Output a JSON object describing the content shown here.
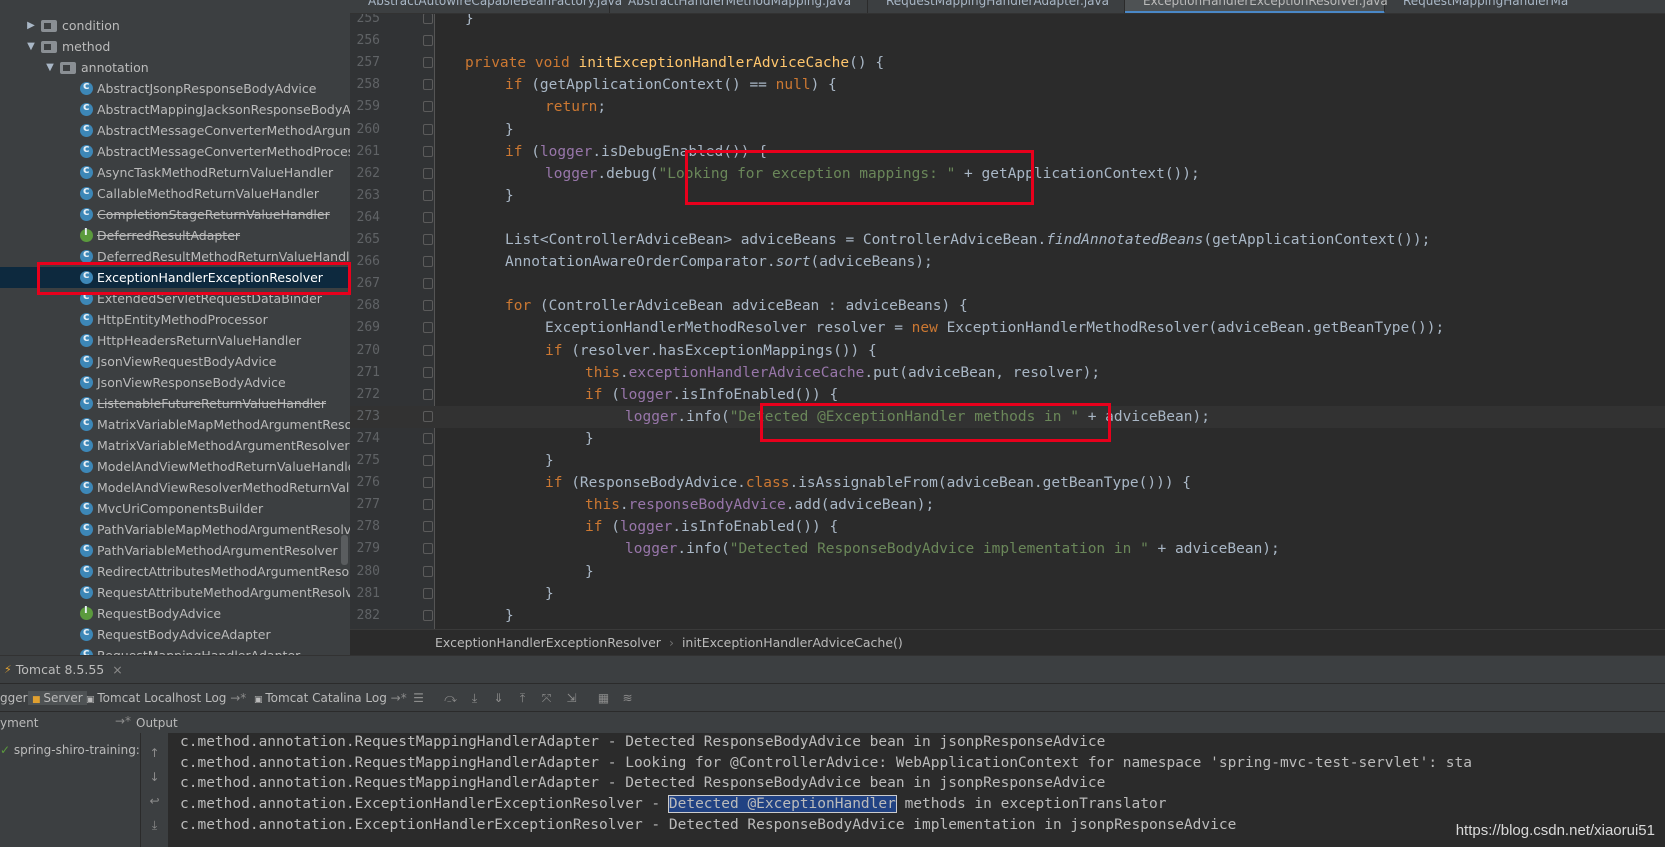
{
  "project_tree": {
    "items": [
      {
        "label": "condition",
        "kind": "folder",
        "level": 1,
        "arrow": "▶"
      },
      {
        "label": "method",
        "kind": "folder",
        "level": 1,
        "arrow": "▼"
      },
      {
        "label": "annotation",
        "kind": "folder",
        "level": 2,
        "arrow": "▼"
      },
      {
        "label": "AbstractJsonpResponseBodyAdvice",
        "kind": "class"
      },
      {
        "label": "AbstractMappingJacksonResponseBodyAd",
        "kind": "class"
      },
      {
        "label": "AbstractMessageConverterMethodArgume",
        "kind": "class"
      },
      {
        "label": "AbstractMessageConverterMethodProcess",
        "kind": "class"
      },
      {
        "label": "AsyncTaskMethodReturnValueHandler",
        "kind": "class"
      },
      {
        "label": "CallableMethodReturnValueHandler",
        "kind": "class"
      },
      {
        "label": "CompletionStageReturnValueHandler",
        "kind": "class",
        "deprecated": true
      },
      {
        "label": "DeferredResultAdapter",
        "kind": "interface",
        "deprecated": true
      },
      {
        "label": "DeferredResultMethodReturnValueHandler",
        "kind": "class"
      },
      {
        "label": "ExceptionHandlerExceptionResolver",
        "kind": "class",
        "selected": true
      },
      {
        "label": "ExtendedServletRequestDataBinder",
        "kind": "class"
      },
      {
        "label": "HttpEntityMethodProcessor",
        "kind": "class"
      },
      {
        "label": "HttpHeadersReturnValueHandler",
        "kind": "class"
      },
      {
        "label": "JsonViewRequestBodyAdvice",
        "kind": "class"
      },
      {
        "label": "JsonViewResponseBodyAdvice",
        "kind": "class"
      },
      {
        "label": "ListenableFutureReturnValueHandler",
        "kind": "class",
        "deprecated": true
      },
      {
        "label": "MatrixVariableMapMethodArgumentResolv",
        "kind": "class"
      },
      {
        "label": "MatrixVariableMethodArgumentResolver",
        "kind": "class"
      },
      {
        "label": "ModelAndViewMethodReturnValueHandler",
        "kind": "class"
      },
      {
        "label": "ModelAndViewResolverMethodReturnValue",
        "kind": "class"
      },
      {
        "label": "MvcUriComponentsBuilder",
        "kind": "class"
      },
      {
        "label": "PathVariableMapMethodArgumentResolver",
        "kind": "class"
      },
      {
        "label": "PathVariableMethodArgumentResolver",
        "kind": "class"
      },
      {
        "label": "RedirectAttributesMethodArgumentResolve",
        "kind": "class"
      },
      {
        "label": "RequestAttributeMethodArgumentResolver",
        "kind": "class"
      },
      {
        "label": "RequestBodyAdvice",
        "kind": "interface"
      },
      {
        "label": "RequestBodyAdviceAdapter",
        "kind": "class"
      },
      {
        "label": "RequestMappingHandlerAdapter",
        "kind": "class"
      }
    ]
  },
  "editor_tabs": [
    {
      "label": "AbstractAutowireCapableBeanFactory.java"
    },
    {
      "label": "AbstractHandlerMethodMapping.java"
    },
    {
      "label": "RequestMappingHandlerAdapter.java"
    },
    {
      "label": "ExceptionHandlerExceptionResolver.java",
      "active": true
    },
    {
      "label": "RequestMappingHandlerMa"
    }
  ],
  "editor": {
    "current_line": "273",
    "lines": [
      {
        "n": "255",
        "tokens": [
          [
            "",
            "}"
          ]
        ],
        "indent": 1
      },
      {
        "n": "256",
        "tokens": [],
        "indent": 0
      },
      {
        "n": "257",
        "tokens": [
          [
            "k",
            "private void "
          ],
          [
            "m",
            "initExceptionHandlerAdviceCache"
          ],
          [
            "",
            "() {"
          ]
        ],
        "indent": 1
      },
      {
        "n": "258",
        "tokens": [
          [
            "k",
            "if "
          ],
          [
            "",
            "(getApplicationContext() == "
          ],
          [
            "k",
            "null"
          ],
          [
            "",
            ") {"
          ]
        ],
        "indent": 2
      },
      {
        "n": "259",
        "tokens": [
          [
            "k",
            "return"
          ],
          [
            "",
            ";"
          ]
        ],
        "indent": 3
      },
      {
        "n": "260",
        "tokens": [
          [
            "",
            "}"
          ]
        ],
        "indent": 2
      },
      {
        "n": "261",
        "tokens": [
          [
            "k",
            "if "
          ],
          [
            "",
            "("
          ],
          [
            "f",
            "logger"
          ],
          [
            "",
            ".isDebugEnabled()) {"
          ]
        ],
        "indent": 2
      },
      {
        "n": "262",
        "tokens": [
          [
            "f",
            "logger"
          ],
          [
            "",
            ".debug("
          ],
          [
            "s",
            "\"Looking for exception mappings: \""
          ],
          [
            "",
            " + getApplicationContext());"
          ]
        ],
        "indent": 3
      },
      {
        "n": "263",
        "tokens": [
          [
            "",
            "}"
          ]
        ],
        "indent": 2
      },
      {
        "n": "264",
        "tokens": [],
        "indent": 0
      },
      {
        "n": "265",
        "tokens": [
          [
            "",
            "List<ControllerAdviceBean> adviceBeans = ControllerAdviceBean."
          ],
          [
            "i",
            "findAnnotatedBeans"
          ],
          [
            "",
            "(getApplicationContext());"
          ]
        ],
        "indent": 2
      },
      {
        "n": "266",
        "tokens": [
          [
            "",
            "AnnotationAwareOrderComparator."
          ],
          [
            "i",
            "sort"
          ],
          [
            "",
            "(adviceBeans);"
          ]
        ],
        "indent": 2
      },
      {
        "n": "267",
        "tokens": [],
        "indent": 0
      },
      {
        "n": "268",
        "tokens": [
          [
            "k",
            "for "
          ],
          [
            "",
            "(ControllerAdviceBean adviceBean : adviceBeans) {"
          ]
        ],
        "indent": 2
      },
      {
        "n": "269",
        "tokens": [
          [
            "",
            "ExceptionHandlerMethodResolver resolver = "
          ],
          [
            "k",
            "new "
          ],
          [
            "",
            "ExceptionHandlerMethodResolver(adviceBean.getBeanType());"
          ]
        ],
        "indent": 3
      },
      {
        "n": "270",
        "tokens": [
          [
            "k",
            "if "
          ],
          [
            "",
            "(resolver.hasExceptionMappings()) {"
          ]
        ],
        "indent": 3
      },
      {
        "n": "271",
        "tokens": [
          [
            "k",
            "this"
          ],
          [
            "",
            "."
          ],
          [
            "f",
            "exceptionHandlerAdviceCache"
          ],
          [
            "",
            ".put(adviceBean, resolver);"
          ]
        ],
        "indent": 4
      },
      {
        "n": "272",
        "tokens": [
          [
            "k",
            "if "
          ],
          [
            "",
            "("
          ],
          [
            "f",
            "logger"
          ],
          [
            "",
            ".isInfoEnabled()) {"
          ]
        ],
        "indent": 4
      },
      {
        "n": "273",
        "tokens": [
          [
            "f",
            "logger"
          ],
          [
            "",
            ".info("
          ],
          [
            "s",
            "\"Detected @ExceptionHandler methods in \""
          ],
          [
            "",
            " + adviceBean);"
          ]
        ],
        "indent": 5
      },
      {
        "n": "274",
        "tokens": [
          [
            "",
            "}"
          ]
        ],
        "indent": 4
      },
      {
        "n": "275",
        "tokens": [
          [
            "",
            "}"
          ]
        ],
        "indent": 3
      },
      {
        "n": "276",
        "tokens": [
          [
            "k",
            "if "
          ],
          [
            "",
            "(ResponseBodyAdvice."
          ],
          [
            "k",
            "class"
          ],
          [
            "",
            ".isAssignableFrom(adviceBean.getBeanType())) {"
          ]
        ],
        "indent": 3
      },
      {
        "n": "277",
        "tokens": [
          [
            "k",
            "this"
          ],
          [
            "",
            "."
          ],
          [
            "f",
            "responseBodyAdvice"
          ],
          [
            "",
            ".add(adviceBean);"
          ]
        ],
        "indent": 4
      },
      {
        "n": "278",
        "tokens": [
          [
            "k",
            "if "
          ],
          [
            "",
            "("
          ],
          [
            "f",
            "logger"
          ],
          [
            "",
            ".isInfoEnabled()) {"
          ]
        ],
        "indent": 4
      },
      {
        "n": "279",
        "tokens": [
          [
            "f",
            "logger"
          ],
          [
            "",
            ".info("
          ],
          [
            "s",
            "\"Detected ResponseBodyAdvice implementation in \""
          ],
          [
            "",
            " + adviceBean);"
          ]
        ],
        "indent": 5
      },
      {
        "n": "280",
        "tokens": [
          [
            "",
            "}"
          ]
        ],
        "indent": 4
      },
      {
        "n": "281",
        "tokens": [
          [
            "",
            "}"
          ]
        ],
        "indent": 3
      },
      {
        "n": "282",
        "tokens": [
          [
            "",
            "}"
          ]
        ],
        "indent": 2
      }
    ]
  },
  "breadcrumb": {
    "class_name": "ExceptionHandlerExceptionResolver",
    "method_name": "initExceptionHandlerAdviceCache()"
  },
  "run_window": {
    "title": "Tomcat 8.5.55",
    "tabs": [
      {
        "label": "gger"
      },
      {
        "label": "Server"
      },
      {
        "label": "Tomcat Localhost Log"
      },
      {
        "label": "Tomcat Catalina Log"
      }
    ],
    "deployment_header": "yment",
    "output_header": "Output",
    "deployment_item": "spring-shiro-training:w",
    "console_lines": [
      {
        "pre": "c.method.annotation.RequestMappingHandlerAdapter - Detected ResponseBodyAdvice bean in jsonpResponseAdvice",
        "hl": "",
        "post": ""
      },
      {
        "pre": "c.method.annotation.RequestMappingHandlerAdapter - Looking for @ControllerAdvice: WebApplicationContext for namespace 'spring-mvc-test-servlet': sta",
        "hl": "",
        "post": ""
      },
      {
        "pre": "c.method.annotation.RequestMappingHandlerAdapter - Detected ResponseBodyAdvice bean in jsonpResponseAdvice",
        "hl": "",
        "post": ""
      },
      {
        "pre": "c.method.annotation.ExceptionHandlerExceptionResolver - ",
        "hl": "Detected @ExceptionHandler",
        "post": " methods in exceptionTranslator"
      },
      {
        "pre": "c.method.annotation.ExceptionHandlerExceptionResolver - Detected ResponseBodyAdvice implementation in jsonpResponseAdvice",
        "hl": "",
        "post": ""
      }
    ]
  },
  "watermark": "https://blog.csdn.net/xiaorui51",
  "colors": {
    "annotation_box": "#e8001c",
    "selection": "#0d293e",
    "keyword": "#cc7832",
    "method": "#ffc66d",
    "string": "#6a8759",
    "field": "#9876aa"
  }
}
